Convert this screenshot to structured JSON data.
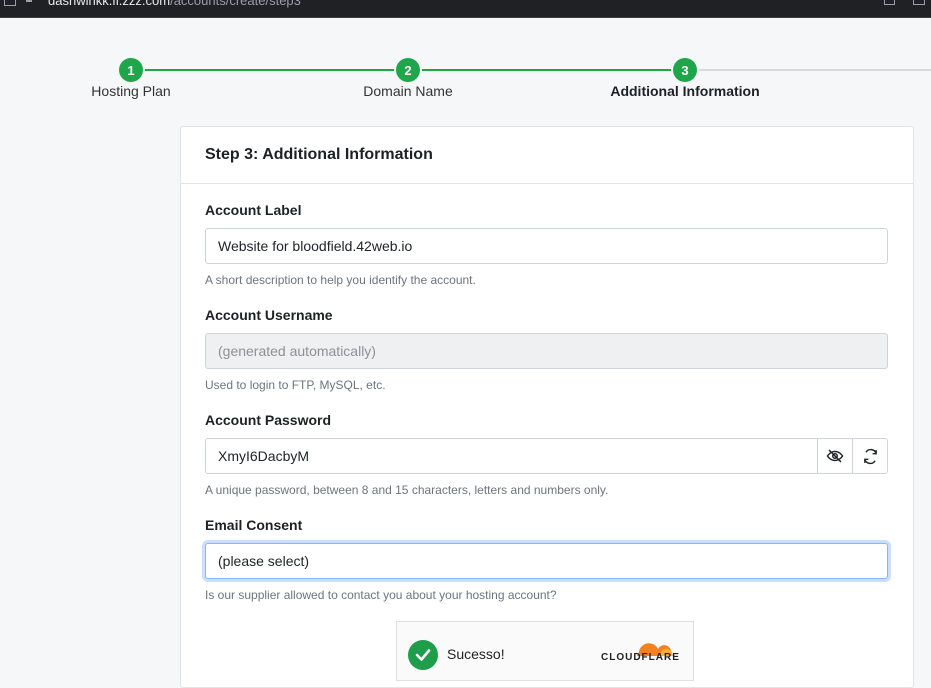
{
  "browser": {
    "url_host": "dashwinkk.fl.zzz.com",
    "url_path": "/accounts/create/step3"
  },
  "stepper": {
    "steps": [
      {
        "number": "1",
        "label": "Hosting Plan"
      },
      {
        "number": "2",
        "label": "Domain Name"
      },
      {
        "number": "3",
        "label": "Additional Information"
      }
    ],
    "active_index": 3
  },
  "card": {
    "title": "Step 3: Additional Information"
  },
  "form": {
    "account_label": {
      "label": "Account Label",
      "value": "Website for bloodfield.42web.io",
      "help": "A short description to help you identify the account."
    },
    "account_username": {
      "label": "Account Username",
      "placeholder": "(generated automatically)",
      "help": "Used to login to FTP, MySQL, etc."
    },
    "account_password": {
      "label": "Account Password",
      "value": "XmyI6DacbyM",
      "help": "A unique password, between 8 and 15 characters, letters and numbers only."
    },
    "email_consent": {
      "label": "Email Consent",
      "selected": "(please select)",
      "help": "Is our supplier allowed to contact you about your hosting account?"
    }
  },
  "captcha": {
    "status": "Sucesso!",
    "brand": "CLOUDFLARE"
  },
  "colors": {
    "step_green": "#1fa64a",
    "focus_blue": "#86b7fe",
    "captcha_green": "#1e9e4a",
    "cloudflare_orange": "#f48120"
  }
}
